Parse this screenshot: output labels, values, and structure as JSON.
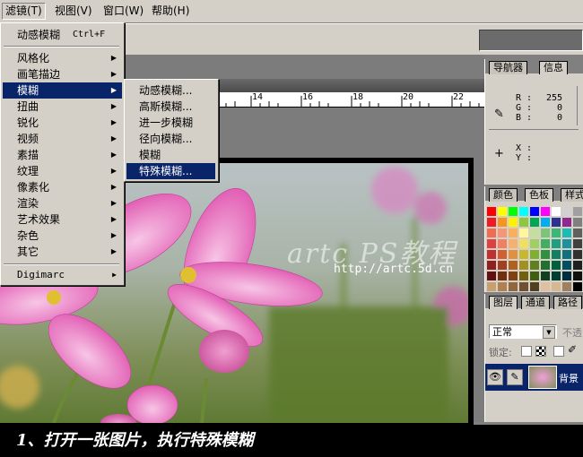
{
  "menubar": {
    "items": [
      {
        "label": "滤镜(T)"
      },
      {
        "label": "视图(V)"
      },
      {
        "label": "窗口(W)"
      },
      {
        "label": "帮助(H)"
      }
    ]
  },
  "filter_menu": {
    "last_filter": {
      "label": "动感模糊",
      "shortcut": "Ctrl+F"
    },
    "items": [
      {
        "label": "风格化"
      },
      {
        "label": "画笔描边"
      },
      {
        "label": "模糊"
      },
      {
        "label": "扭曲"
      },
      {
        "label": "锐化"
      },
      {
        "label": "视频"
      },
      {
        "label": "素描"
      },
      {
        "label": "纹理"
      },
      {
        "label": "像素化"
      },
      {
        "label": "渲染"
      },
      {
        "label": "艺术效果"
      },
      {
        "label": "杂色"
      },
      {
        "label": "其它"
      }
    ],
    "digimarc": "Digimarc"
  },
  "blur_submenu": {
    "items": [
      {
        "label": "动感模糊..."
      },
      {
        "label": "高斯模糊..."
      },
      {
        "label": "进一步模糊"
      },
      {
        "label": "径向模糊..."
      },
      {
        "label": "模糊"
      },
      {
        "label": "特殊模糊..."
      }
    ]
  },
  "ruler": {
    "labels": [
      "14",
      "16",
      "18",
      "20",
      "22"
    ]
  },
  "navigator_panel": {
    "tabs": [
      "导航器",
      "信息"
    ],
    "rgb": [
      {
        "k": "R",
        "v": "255"
      },
      {
        "k": "G",
        "v": "0"
      },
      {
        "k": "B",
        "v": "0"
      }
    ],
    "xy": [
      {
        "k": "X",
        "v": ""
      },
      {
        "k": "Y",
        "v": ""
      }
    ]
  },
  "color_panel": {
    "tabs": [
      "颜色",
      "色板",
      "样式"
    ]
  },
  "layers_panel": {
    "tabs": [
      "图层",
      "通道",
      "路径"
    ],
    "blend_mode": "正常",
    "opacity_label": "不透",
    "lock_label": "锁定:",
    "layer_name": "背景"
  },
  "watermark": {
    "title": "artc PS教程",
    "url": "http://artc.5d.cn"
  },
  "caption": "1、打开一张图片，执行特殊模糊",
  "swatch_colors": [
    "#ff0000",
    "#ffff00",
    "#00ff00",
    "#00ffff",
    "#0000ff",
    "#ff00ff",
    "#ffffff",
    "#d0d0d0",
    "#a0a0a0",
    "#ed1c24",
    "#f7941d",
    "#fff200",
    "#8dc63f",
    "#00a651",
    "#00aeef",
    "#2e3192",
    "#92278f",
    "#808080",
    "#f26c4f",
    "#f69679",
    "#fbaf5d",
    "#fff799",
    "#c4df9b",
    "#7cc576",
    "#3bb878",
    "#1cbbb4",
    "#606060",
    "#e04040",
    "#f08060",
    "#f8b070",
    "#f0e060",
    "#a0d060",
    "#40b060",
    "#20a080",
    "#2090a0",
    "#404040",
    "#c03030",
    "#d06030",
    "#e09040",
    "#c8b830",
    "#80b030",
    "#309040",
    "#108060",
    "#107080",
    "#303030",
    "#902020",
    "#a04020",
    "#b06020",
    "#a09020",
    "#608020",
    "#207030",
    "#006040",
    "#005060",
    "#202020",
    "#601010",
    "#703010",
    "#804010",
    "#706010",
    "#406010",
    "#104020",
    "#004030",
    "#003040",
    "#101010",
    "#c8a070",
    "#b08050",
    "#906840",
    "#705030",
    "#504020",
    "#e0c0a0",
    "#d8b890",
    "#a08060",
    "#000000"
  ]
}
